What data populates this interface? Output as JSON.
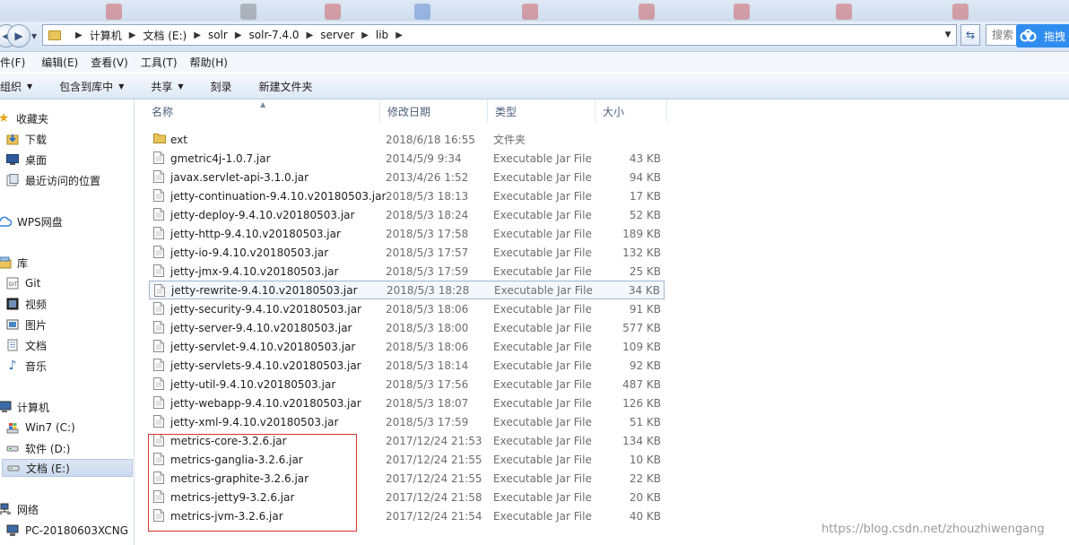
{
  "address": {
    "crumbs": [
      "计算机",
      "文档 (E:)",
      "solr",
      "solr-7.4.0",
      "server",
      "lib"
    ],
    "search_placeholder": "搜索",
    "cloud_label": "拖拽"
  },
  "menu": [
    "件(F)",
    "编辑(E)",
    "查看(V)",
    "工具(T)",
    "帮助(H)"
  ],
  "commands": {
    "organize": "组织",
    "include_library": "包含到库中",
    "share": "共享",
    "burn": "刻录",
    "new_folder": "新建文件夹"
  },
  "nav": {
    "favorites": "收藏夹",
    "downloads": "下载",
    "desktop": "桌面",
    "recent": "最近访问的位置",
    "wps": "WPS网盘",
    "libraries": "库",
    "git": "Git",
    "videos": "视频",
    "pictures": "图片",
    "documents": "文档",
    "music": "音乐",
    "computer": "计算机",
    "drive_c": "Win7 (C:)",
    "drive_d": "软件 (D:)",
    "drive_e": "文档 (E:)",
    "network": "网络",
    "pc": "PC-20180603XCNG"
  },
  "columns": {
    "name": "名称",
    "modified": "修改日期",
    "type": "类型",
    "size": "大小"
  },
  "files": [
    {
      "name": "ext",
      "date": "2018/6/18 16:55",
      "type": "文件夹",
      "size": ""
    },
    {
      "name": "gmetric4j-1.0.7.jar",
      "date": "2014/5/9 9:34",
      "type": "Executable Jar File",
      "size": "43 KB"
    },
    {
      "name": "javax.servlet-api-3.1.0.jar",
      "date": "2013/4/26 1:52",
      "type": "Executable Jar File",
      "size": "94 KB"
    },
    {
      "name": "jetty-continuation-9.4.10.v20180503.jar",
      "date": "2018/5/3 18:13",
      "type": "Executable Jar File",
      "size": "17 KB"
    },
    {
      "name": "jetty-deploy-9.4.10.v20180503.jar",
      "date": "2018/5/3 18:24",
      "type": "Executable Jar File",
      "size": "52 KB"
    },
    {
      "name": "jetty-http-9.4.10.v20180503.jar",
      "date": "2018/5/3 17:58",
      "type": "Executable Jar File",
      "size": "189 KB"
    },
    {
      "name": "jetty-io-9.4.10.v20180503.jar",
      "date": "2018/5/3 17:57",
      "type": "Executable Jar File",
      "size": "132 KB"
    },
    {
      "name": "jetty-jmx-9.4.10.v20180503.jar",
      "date": "2018/5/3 17:59",
      "type": "Executable Jar File",
      "size": "25 KB"
    },
    {
      "name": "jetty-rewrite-9.4.10.v20180503.jar",
      "date": "2018/5/3 18:28",
      "type": "Executable Jar File",
      "size": "34 KB"
    },
    {
      "name": "jetty-security-9.4.10.v20180503.jar",
      "date": "2018/5/3 18:06",
      "type": "Executable Jar File",
      "size": "91 KB"
    },
    {
      "name": "jetty-server-9.4.10.v20180503.jar",
      "date": "2018/5/3 18:00",
      "type": "Executable Jar File",
      "size": "577 KB"
    },
    {
      "name": "jetty-servlet-9.4.10.v20180503.jar",
      "date": "2018/5/3 18:06",
      "type": "Executable Jar File",
      "size": "109 KB"
    },
    {
      "name": "jetty-servlets-9.4.10.v20180503.jar",
      "date": "2018/5/3 18:14",
      "type": "Executable Jar File",
      "size": "92 KB"
    },
    {
      "name": "jetty-util-9.4.10.v20180503.jar",
      "date": "2018/5/3 17:56",
      "type": "Executable Jar File",
      "size": "487 KB"
    },
    {
      "name": "jetty-webapp-9.4.10.v20180503.jar",
      "date": "2018/5/3 18:07",
      "type": "Executable Jar File",
      "size": "126 KB"
    },
    {
      "name": "jetty-xml-9.4.10.v20180503.jar",
      "date": "2018/5/3 17:59",
      "type": "Executable Jar File",
      "size": "51 KB"
    },
    {
      "name": "metrics-core-3.2.6.jar",
      "date": "2017/12/24 21:53",
      "type": "Executable Jar File",
      "size": "134 KB"
    },
    {
      "name": "metrics-ganglia-3.2.6.jar",
      "date": "2017/12/24 21:55",
      "type": "Executable Jar File",
      "size": "10 KB"
    },
    {
      "name": "metrics-graphite-3.2.6.jar",
      "date": "2017/12/24 21:55",
      "type": "Executable Jar File",
      "size": "22 KB"
    },
    {
      "name": "metrics-jetty9-3.2.6.jar",
      "date": "2017/12/24 21:58",
      "type": "Executable Jar File",
      "size": "20 KB"
    },
    {
      "name": "metrics-jvm-3.2.6.jar",
      "date": "2017/12/24 21:54",
      "type": "Executable Jar File",
      "size": "40 KB"
    }
  ],
  "watermark": "https://blog.csdn.net/zhouzhiwengang"
}
